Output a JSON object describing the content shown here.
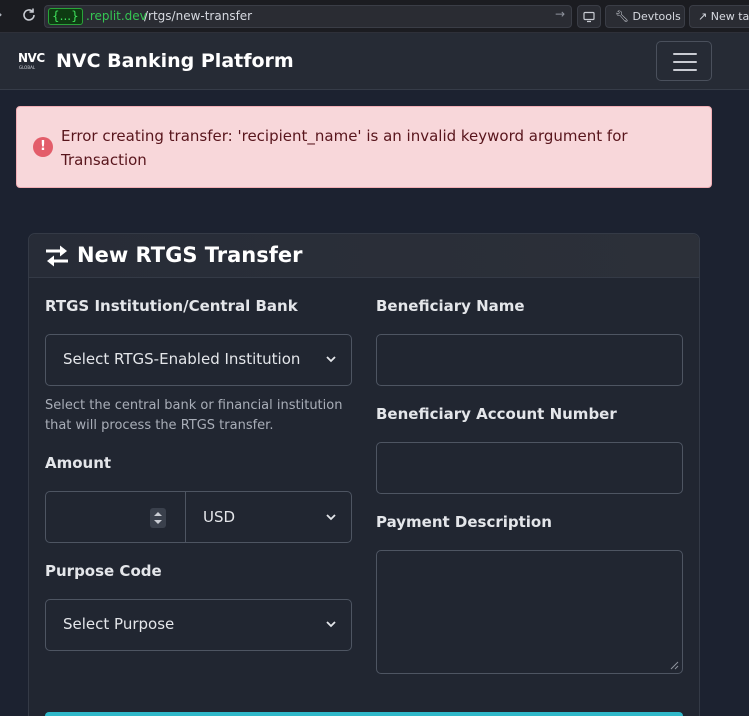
{
  "browser": {
    "domain_badge": "{...}",
    "domain_rest": ".replit.dev",
    "path": "/rtgs/new-transfer",
    "devtools_label": "Devtools",
    "new_tab_label": "New tab"
  },
  "navbar": {
    "logo_text": "NVC",
    "logo_subtext": "GLOBAL",
    "brand": "NVC Banking Platform"
  },
  "alert": {
    "message": "Error creating transfer: 'recipient_name' is an invalid keyword argument for Transaction",
    "icon": "exclamation-circle-icon"
  },
  "card": {
    "title": "New RTGS Transfer",
    "icon": "exchange-icon"
  },
  "form": {
    "institution_label": "RTGS Institution/Central Bank",
    "institution_value": "Select RTGS-Enabled Institution",
    "institution_help": "Select the central bank or financial institution that will process the RTGS transfer.",
    "amount_label": "Amount",
    "amount_value": "",
    "currency_value": "USD",
    "purpose_label": "Purpose Code",
    "purpose_value": "Select Purpose",
    "beneficiary_name_label": "Beneficiary Name",
    "beneficiary_name_value": "",
    "beneficiary_account_label": "Beneficiary Account Number",
    "beneficiary_account_value": "",
    "description_label": "Payment Description",
    "description_value": ""
  },
  "colors": {
    "page_bg": "#1c2230",
    "alert_bg": "#f8d7da",
    "alert_text": "#58151c",
    "accent": "#2fb8c9"
  }
}
